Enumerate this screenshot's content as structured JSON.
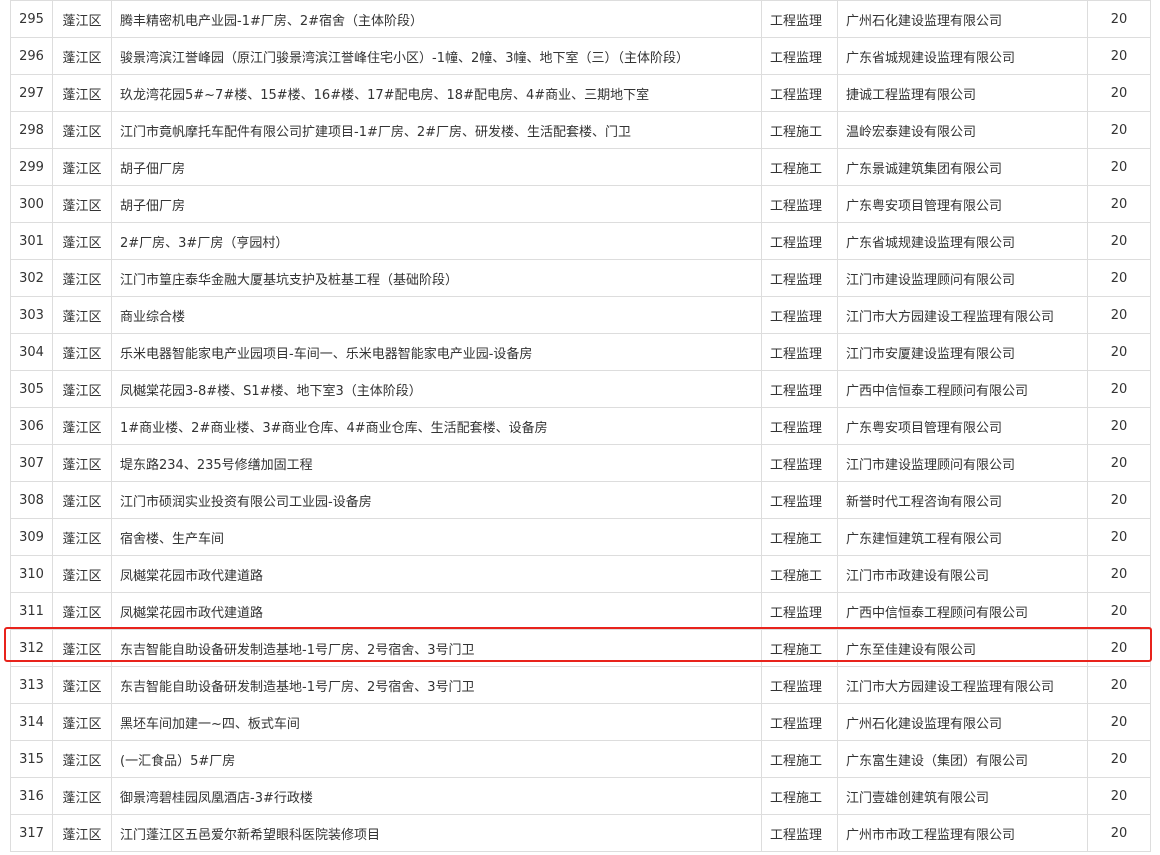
{
  "rows": [
    {
      "no": "295",
      "district": "蓬江区",
      "project": "腾丰精密机电产业园-1#厂房、2#宿舍（主体阶段）",
      "type": "工程监理",
      "company": "广州石化建设监理有限公司",
      "score": "20"
    },
    {
      "no": "296",
      "district": "蓬江区",
      "project": "骏景湾滨江誉峰园（原江门骏景湾滨江誉峰住宅小区）-1幢、2幢、3幢、地下室（三）（主体阶段）",
      "type": "工程监理",
      "company": "广东省城规建设监理有限公司",
      "score": "20"
    },
    {
      "no": "297",
      "district": "蓬江区",
      "project": "玖龙湾花园5#~7#楼、15#楼、16#楼、17#配电房、18#配电房、4#商业、三期地下室",
      "type": "工程监理",
      "company": "捷诚工程监理有限公司",
      "score": "20"
    },
    {
      "no": "298",
      "district": "蓬江区",
      "project": "江门市竟帆摩托车配件有限公司扩建项目-1#厂房、2#厂房、研发楼、生活配套楼、门卫",
      "type": "工程施工",
      "company": "温岭宏泰建设有限公司",
      "score": "20"
    },
    {
      "no": "299",
      "district": "蓬江区",
      "project": "胡子佃厂房",
      "type": "工程施工",
      "company": "广东景诚建筑集团有限公司",
      "score": "20"
    },
    {
      "no": "300",
      "district": "蓬江区",
      "project": "胡子佃厂房",
      "type": "工程监理",
      "company": "广东粤安项目管理有限公司",
      "score": "20"
    },
    {
      "no": "301",
      "district": "蓬江区",
      "project": "2#厂房、3#厂房（亨园村）",
      "type": "工程监理",
      "company": "广东省城规建设监理有限公司",
      "score": "20"
    },
    {
      "no": "302",
      "district": "蓬江区",
      "project": "江门市篁庄泰华金融大厦基坑支护及桩基工程（基础阶段）",
      "type": "工程监理",
      "company": "江门市建设监理顾问有限公司",
      "score": "20"
    },
    {
      "no": "303",
      "district": "蓬江区",
      "project": "商业综合楼",
      "type": "工程监理",
      "company": "江门市大方园建设工程监理有限公司",
      "score": "20"
    },
    {
      "no": "304",
      "district": "蓬江区",
      "project": "乐米电器智能家电产业园项目-车间一、乐米电器智能家电产业园-设备房",
      "type": "工程监理",
      "company": "江门市安厦建设监理有限公司",
      "score": "20"
    },
    {
      "no": "305",
      "district": "蓬江区",
      "project": "凤樾棠花园3-8#楼、S1#楼、地下室3（主体阶段）",
      "type": "工程监理",
      "company": "广西中信恒泰工程顾问有限公司",
      "score": "20"
    },
    {
      "no": "306",
      "district": "蓬江区",
      "project": "1#商业楼、2#商业楼、3#商业仓库、4#商业仓库、生活配套楼、设备房",
      "type": "工程监理",
      "company": "广东粤安项目管理有限公司",
      "score": "20"
    },
    {
      "no": "307",
      "district": "蓬江区",
      "project": "堤东路234、235号修缮加固工程",
      "type": "工程监理",
      "company": "江门市建设监理顾问有限公司",
      "score": "20"
    },
    {
      "no": "308",
      "district": "蓬江区",
      "project": "江门市硕润实业投资有限公司工业园-设备房",
      "type": "工程监理",
      "company": "新誉时代工程咨询有限公司",
      "score": "20"
    },
    {
      "no": "309",
      "district": "蓬江区",
      "project": "宿舍楼、生产车间",
      "type": "工程施工",
      "company": "广东建恒建筑工程有限公司",
      "score": "20"
    },
    {
      "no": "310",
      "district": "蓬江区",
      "project": "凤樾棠花园市政代建道路",
      "type": "工程施工",
      "company": "江门市市政建设有限公司",
      "score": "20"
    },
    {
      "no": "311",
      "district": "蓬江区",
      "project": "凤樾棠花园市政代建道路",
      "type": "工程监理",
      "company": "广西中信恒泰工程顾问有限公司",
      "score": "20"
    },
    {
      "no": "312",
      "district": "蓬江区",
      "project": "东吉智能自助设备研发制造基地-1号厂房、2号宿舍、3号门卫",
      "type": "工程施工",
      "company": "广东至佳建设有限公司",
      "score": "20"
    },
    {
      "no": "313",
      "district": "蓬江区",
      "project": "东吉智能自助设备研发制造基地-1号厂房、2号宿舍、3号门卫",
      "type": "工程监理",
      "company": "江门市大方园建设工程监理有限公司",
      "score": "20"
    },
    {
      "no": "314",
      "district": "蓬江区",
      "project": "黑坯车间加建一~四、板式车间",
      "type": "工程监理",
      "company": "广州石化建设监理有限公司",
      "score": "20"
    },
    {
      "no": "315",
      "district": "蓬江区",
      "project": "(一汇食品）5#厂房",
      "type": "工程施工",
      "company": "广东富生建设（集团）有限公司",
      "score": "20"
    },
    {
      "no": "316",
      "district": "蓬江区",
      "project": "御景湾碧桂园凤凰酒店-3#行政楼",
      "type": "工程施工",
      "company": "江门壹雄创建筑有限公司",
      "score": "20"
    },
    {
      "no": "317",
      "district": "蓬江区",
      "project": "江门蓬江区五邑爱尔新希望眼科医院装修项目",
      "type": "工程监理",
      "company": "广州市市政工程监理有限公司",
      "score": "20"
    }
  ],
  "highlight": {
    "row_no": "312",
    "color": "#e8231c"
  }
}
